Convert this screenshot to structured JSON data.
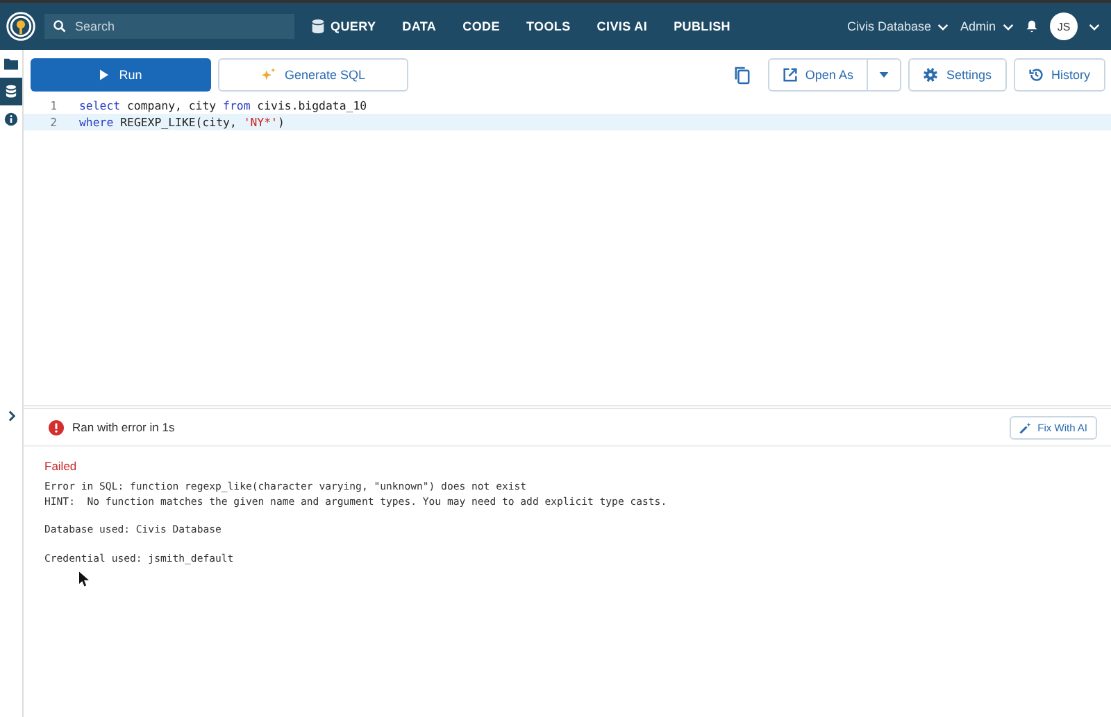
{
  "topbar": {
    "search": {
      "placeholder": "Search"
    },
    "nav": [
      {
        "label": "QUERY",
        "icon": true
      },
      {
        "label": "DATA",
        "icon": false
      },
      {
        "label": "CODE",
        "icon": false
      },
      {
        "label": "TOOLS",
        "icon": false
      },
      {
        "label": "CIVIS AI",
        "icon": false
      },
      {
        "label": "PUBLISH",
        "icon": false
      }
    ],
    "database": "Civis Database",
    "role": "Admin",
    "avatar": "JS"
  },
  "sidebar": {
    "items": [
      {
        "kind": "folder",
        "selected": false
      },
      {
        "kind": "database",
        "selected": true
      },
      {
        "kind": "info",
        "selected": false
      }
    ]
  },
  "toolbar": {
    "run": "Run",
    "generate": "Generate SQL",
    "open_as": "Open As",
    "settings": "Settings",
    "history": "History"
  },
  "editor": {
    "lines": [
      {
        "number": "1",
        "highlighted": false,
        "tokens": [
          {
            "kind": "keyword",
            "text": "select"
          },
          {
            "kind": "plain",
            "text": " company, city "
          },
          {
            "kind": "keyword",
            "text": "from"
          },
          {
            "kind": "plain",
            "text": " civis.bigdata_10"
          }
        ]
      },
      {
        "number": "2",
        "highlighted": true,
        "tokens": [
          {
            "kind": "keyword",
            "text": "where"
          },
          {
            "kind": "plain",
            "text": " REGEXP_LIKE(city, "
          },
          {
            "kind": "string",
            "text": "'NY*'"
          },
          {
            "kind": "plain",
            "text": ")"
          }
        ]
      }
    ]
  },
  "results": {
    "status": "Ran with error in 1s",
    "fix": "Fix With AI",
    "title": "Failed",
    "messages": [
      "Error in SQL: function regexp_like(character varying, \"unknown\") does not exist\nHINT:  No function matches the given name and argument types. You may need to add explicit type casts.",
      "Database used: Civis Database",
      "Credential used: jsmith_default"
    ]
  }
}
